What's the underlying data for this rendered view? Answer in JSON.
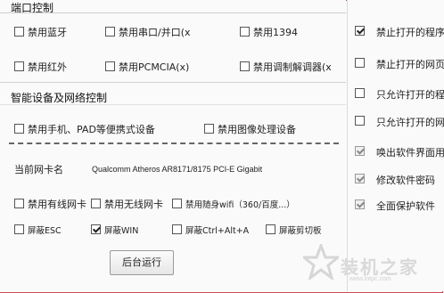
{
  "port_control": {
    "title": "端口控制",
    "items": [
      {
        "label": "禁用蓝牙",
        "checked": false
      },
      {
        "label": "禁用串口/并口(x",
        "checked": false
      },
      {
        "label": "禁用1394",
        "checked": false
      },
      {
        "label": "禁用红外",
        "checked": false
      },
      {
        "label": "禁用PCMCIA(x)",
        "checked": false
      },
      {
        "label": "禁用调制解调器(x",
        "checked": false
      }
    ]
  },
  "device_control": {
    "title": "智能设备及网络控制",
    "items": [
      {
        "label": "禁用手机、PAD等便携式设备",
        "checked": false
      },
      {
        "label": "禁用图像处理设备",
        "checked": false
      }
    ],
    "nic_label": "当前网卡名",
    "nic_value": "Qualcomm Atheros AR8171/8175 PCI-E Gigabit",
    "net_items": [
      {
        "label": "禁用有线网卡",
        "checked": false
      },
      {
        "label": "禁用无线网卡",
        "checked": false
      },
      {
        "label": "禁用随身wifi（360/百度...）",
        "checked": false
      }
    ],
    "shield_items": [
      {
        "label": "屏蔽ESC",
        "checked": false
      },
      {
        "label": "屏蔽WIN",
        "checked": true
      },
      {
        "label": "屏蔽Ctrl+Alt+A",
        "checked": false
      },
      {
        "label": "屏蔽剪切板",
        "checked": false
      }
    ]
  },
  "right_options": [
    {
      "label": "禁止打开的程序",
      "checked": true,
      "enabled": true
    },
    {
      "label": "禁止打开的网页",
      "checked": false,
      "enabled": true
    },
    {
      "label": "只允许打开的程",
      "checked": false,
      "enabled": true
    },
    {
      "label": "只允许打开的网",
      "checked": false,
      "enabled": true
    },
    {
      "label": "唤出软件界面用",
      "checked": true,
      "enabled": false
    },
    {
      "label": "修改软件密码",
      "checked": true,
      "enabled": false
    },
    {
      "label": "全面保护软件",
      "checked": true,
      "enabled": false
    }
  ],
  "run_button": "后台运行",
  "watermark": {
    "text": "装机之家",
    "url": "www.lotpc.com"
  },
  "colors": {
    "frame_border": "#c94c50",
    "watermark": "#d9d9d9"
  }
}
